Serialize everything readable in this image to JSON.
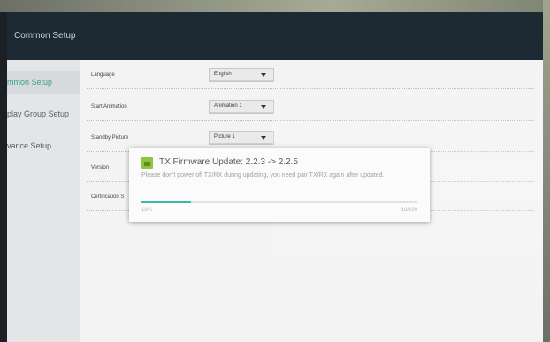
{
  "header": {
    "title": "Common Setup"
  },
  "sidebar": {
    "items": [
      {
        "label": "mmon Setup",
        "active": true
      },
      {
        "label": "play Group Setup",
        "active": false
      },
      {
        "label": "vance Setup",
        "active": false
      }
    ]
  },
  "settings": {
    "rows": [
      {
        "label": "Language",
        "value": "English"
      },
      {
        "label": "Start Animation",
        "value": "Animation 1"
      },
      {
        "label": "Standby Picture",
        "value": "Picture 1"
      },
      {
        "label": "Version",
        "value": ""
      },
      {
        "label": "Certification S",
        "value": ""
      }
    ]
  },
  "dialog": {
    "title": "TX Firmware Update: 2.2.3 -> 2.2.5",
    "message": "Please don't power off TX/RX during updating, you need pair TX/RX again after updated.",
    "progress": {
      "percent_label": "18%",
      "count_label": "18/100",
      "fraction": 0.18
    }
  },
  "colors": {
    "accent": "#3fb9a5",
    "header_bg": "#1e2a33"
  }
}
